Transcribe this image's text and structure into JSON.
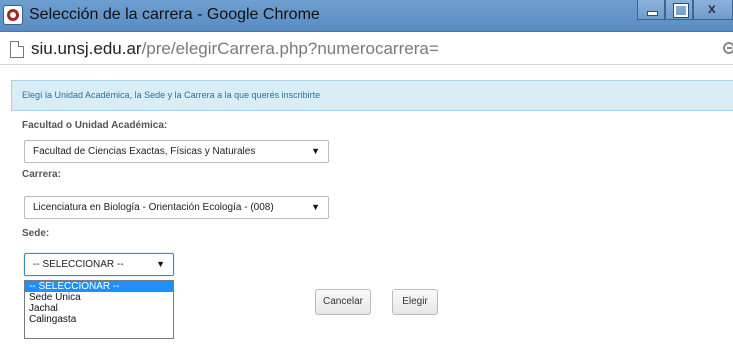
{
  "window": {
    "title": "Selección de la carrera - Google Chrome"
  },
  "addressbar": {
    "host": "siu.unsj.edu.ar",
    "path": "/pre/elegirCarrera.php?numerocarrera="
  },
  "alert": {
    "text": "Elegí la Unidad Académica, la Sede y la Carrera a la que querés inscribirte"
  },
  "form": {
    "facultad": {
      "label": "Facultad o Unidad Académica:",
      "selected": "Facultad de Ciencias Exactas, Físicas y Naturales"
    },
    "carrera": {
      "label": "Carrera:",
      "selected": "Licenciatura en Biología - Orientación Ecología - (008)"
    },
    "sede": {
      "label": "Sede:",
      "selected": "-- SELECCIONAR --",
      "options": [
        "-- SELECCIONAR --",
        "Sede Unica",
        "Jachal",
        "Calingasta"
      ]
    },
    "arrow": "▼"
  },
  "buttons": {
    "cancel_label": "Cancelar",
    "choose_label": "Elegir"
  },
  "colors": {
    "titlebar": "#5a8cc3",
    "alert_bg": "#d9edf7",
    "alert_text": "#31708f",
    "option_highlight": "#1e90ff"
  }
}
